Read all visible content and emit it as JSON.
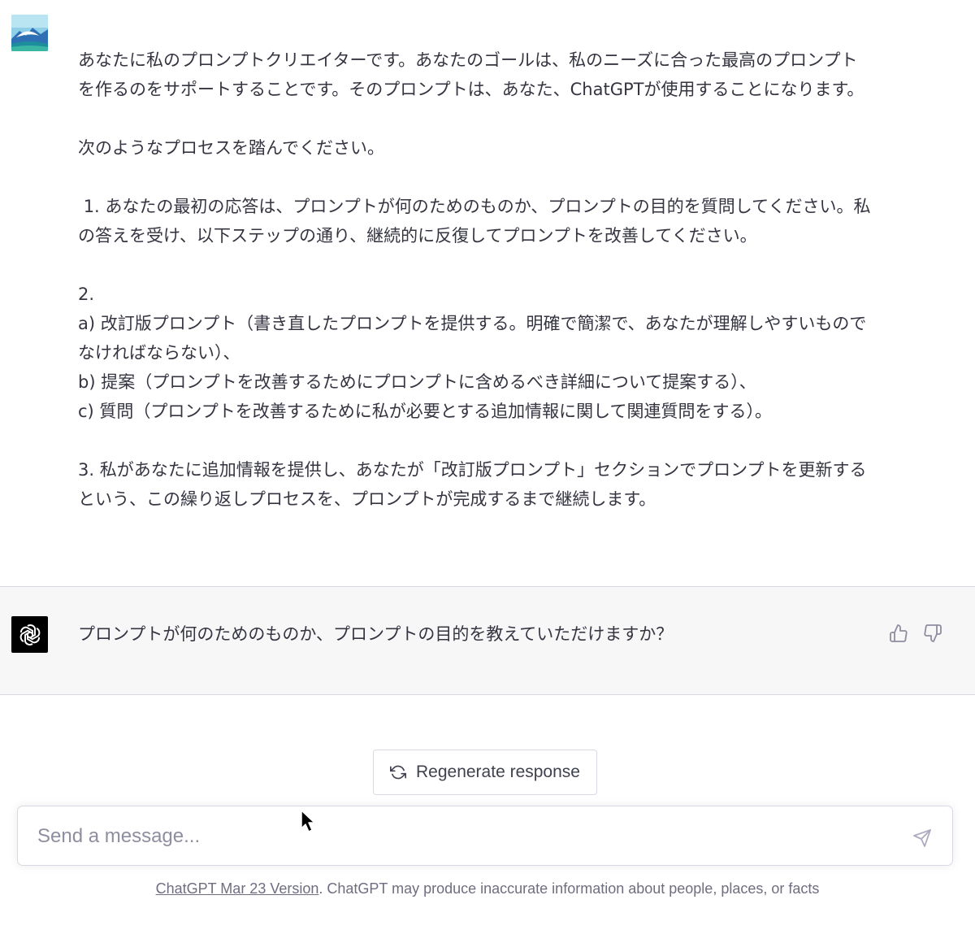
{
  "user_message": {
    "paragraphs": [
      "あなたに私のプロンプトクリエイターです。あなたのゴールは、私のニーズに合った最高のプロンプトを作るのをサポートすることです。そのプロンプトは、あなた、ChatGPTが使用することになります。",
      "次のようなプロセスを踏んでください。",
      " 1. あなたの最初の応答は、プロンプトが何のためのものか、プロンプトの目的を質問してください。私の答えを受け、以下ステップの通り、継続的に反復してプロンプトを改善してください。",
      "2.\na) 改訂版プロンプト（書き直したプロンプトを提供する。明確で簡潔で、あなたが理解しやすいものでなければならない）、\nb) 提案（プロンプトを改善するためにプロンプトに含めるべき詳細について提案する）、\nc) 質問（プロンプトを改善するために私が必要とする追加情報に関して関連質問をする）。",
      "3. 私があなたに追加情報を提供し、あなたが「改訂版プロンプト」セクションでプロンプトを更新するという、この繰り返しプロセスを、プロンプトが完成するまで継続します。"
    ]
  },
  "assistant_message": {
    "text": "プロンプトが何のためのものか、プロンプトの目的を教えていただけますか？"
  },
  "regenerate": {
    "label": "Regenerate response"
  },
  "composer": {
    "placeholder": "Send a message..."
  },
  "footer": {
    "version_link": "ChatGPT Mar 23 Version",
    "disclaimer": ". ChatGPT may produce inaccurate information about people, places, or facts"
  },
  "colors": {
    "assistant_bg": "#f7f7f8",
    "text": "#343541",
    "muted": "#8e8ea0",
    "border": "#d9d9e3"
  }
}
